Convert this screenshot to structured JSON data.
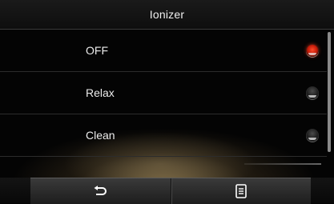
{
  "header": {
    "title": "Ionizer"
  },
  "options": [
    {
      "label": "OFF",
      "selected": true
    },
    {
      "label": "Relax",
      "selected": false
    },
    {
      "label": "Clean",
      "selected": false
    }
  ],
  "toolbar": {
    "back_icon": "back-arrow-icon",
    "menu_icon": "menu-icon"
  },
  "colors": {
    "accent_selected": "#e0301a",
    "background": "#040404",
    "glow": "#c9aa6e"
  }
}
